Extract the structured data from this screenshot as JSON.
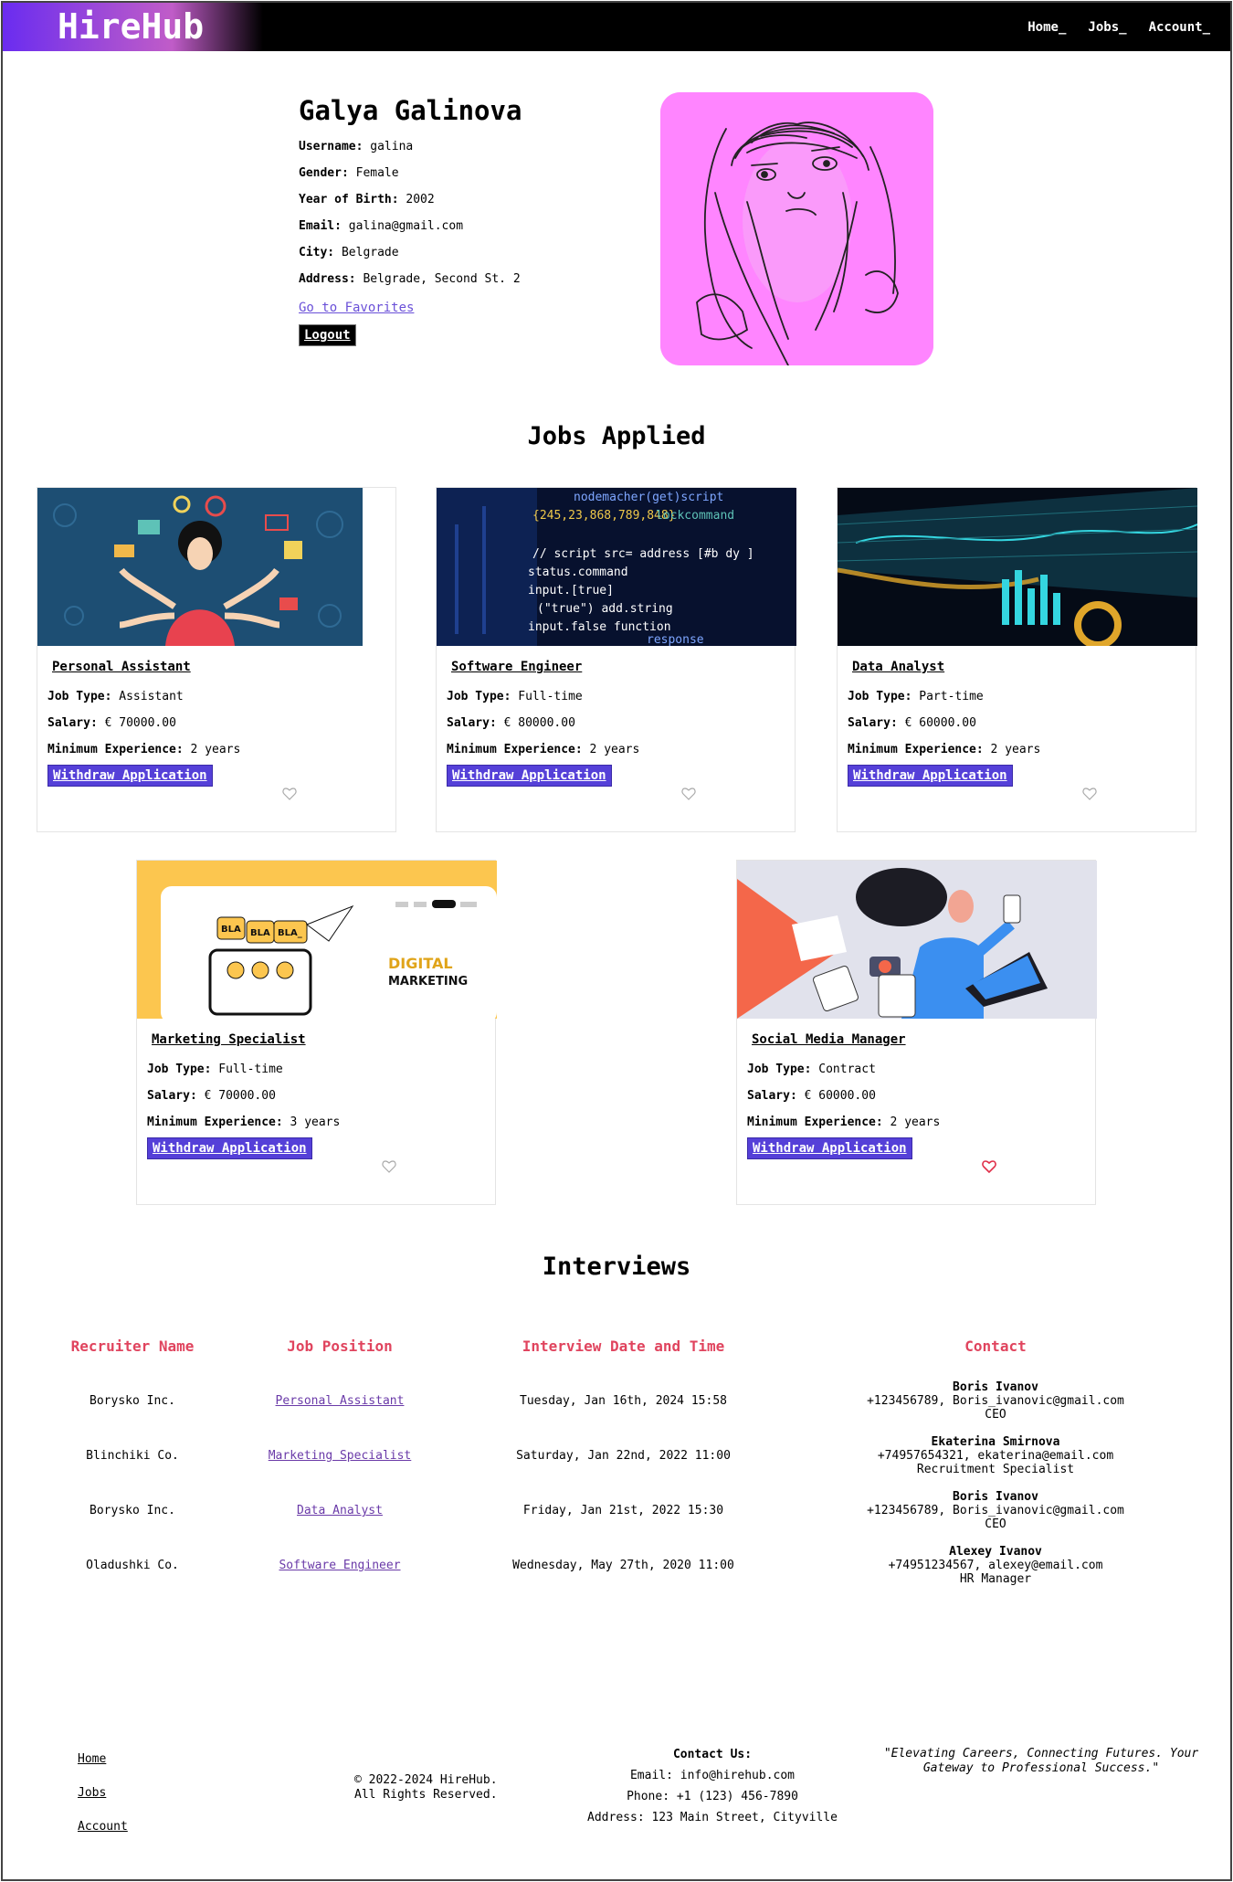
{
  "header": {
    "logo": "HireHub",
    "nav": [
      "Home_",
      "Jobs_",
      "Account_"
    ]
  },
  "profile": {
    "name": "Galya Galinova",
    "fields": [
      {
        "label": "Username:",
        "value": "galina"
      },
      {
        "label": "Gender:",
        "value": "Female"
      },
      {
        "label": "Year of Birth:",
        "value": "2002"
      },
      {
        "label": "Email:",
        "value": "galina@gmail.com"
      },
      {
        "label": "City:",
        "value": "Belgrade"
      },
      {
        "label": "Address:",
        "value": "Belgrade, Second St. 2"
      }
    ],
    "favorites_link": "Go to Favorites",
    "logout": "Logout"
  },
  "jobs_applied": {
    "title": "Jobs Applied",
    "labels": {
      "type": "Job Type:",
      "salary": "Salary:",
      "exp": "Minimum Experience:",
      "withdraw": "Withdraw Application"
    },
    "jobs": [
      {
        "title": "Personal Assistant",
        "type": "Assistant",
        "salary": "€ 70000.00",
        "experience": "2 years",
        "favorite": false
      },
      {
        "title": "Software Engineer",
        "type": "Full-time",
        "salary": "€ 80000.00",
        "experience": "2 years",
        "favorite": false
      },
      {
        "title": "Data Analyst",
        "type": "Part-time",
        "salary": "€ 60000.00",
        "experience": "2 years",
        "favorite": false
      },
      {
        "title": "Marketing Specialist",
        "type": "Full-time",
        "salary": "€ 70000.00",
        "experience": "3 years",
        "favorite": false
      },
      {
        "title": "Social Media Manager",
        "type": "Contract",
        "salary": "€ 60000.00",
        "experience": "2 years",
        "favorite": true
      }
    ],
    "image_text": {
      "bla1": "BLA",
      "bla2": "BLA",
      "bla3": "BLA_",
      "digital": "DIGITAL",
      "marketing": "MARKETING"
    }
  },
  "interviews": {
    "title": "Interviews",
    "headers": [
      "Recruiter Name",
      "Job Position",
      "Interview Date and Time",
      "Contact"
    ],
    "rows": [
      {
        "recruiter": "Borysko Inc.",
        "position": "Personal Assistant",
        "datetime": "Tuesday, Jan 16th, 2024 15:58",
        "contact_name": "Boris Ivanov",
        "contact_line": "+123456789, Boris_ivanovic@gmail.com",
        "contact_role": "CEO"
      },
      {
        "recruiter": "Blinchiki Co.",
        "position": "Marketing Specialist",
        "datetime": "Saturday, Jan 22nd, 2022 11:00",
        "contact_name": "Ekaterina Smirnova",
        "contact_line": "+74957654321, ekaterina@email.com",
        "contact_role": "Recruitment Specialist"
      },
      {
        "recruiter": "Borysko Inc.",
        "position": "Data Analyst",
        "datetime": "Friday, Jan 21st, 2022 15:30",
        "contact_name": "Boris Ivanov",
        "contact_line": "+123456789, Boris_ivanovic@gmail.com",
        "contact_role": "CEO"
      },
      {
        "recruiter": "Oladushki Co.",
        "position": "Software Engineer",
        "datetime": "Wednesday, May 27th, 2020 11:00",
        "contact_name": "Alexey Ivanov",
        "contact_line": "+74951234567, alexey@email.com",
        "contact_role": "HR Manager"
      }
    ]
  },
  "footer": {
    "links": [
      "Home",
      "Jobs",
      "Account"
    ],
    "copyright_1": "© 2022-2024 HireHub.",
    "copyright_2": "All Rights Reserved.",
    "contact_title": "Contact Us:",
    "contact_email": "Email: info@hirehub.com",
    "contact_phone": "Phone: +1 (123) 456-7890",
    "contact_address": "Address: 123 Main Street, Cityville",
    "quote": "\"Elevating Careers, Connecting Futures. Your Gateway to Professional Success.\""
  },
  "colors": {
    "accent": "#5540d8",
    "heading_red": "#e0445e",
    "avatar_bg": "#ff85ff",
    "heart_active": "#e0304a"
  }
}
